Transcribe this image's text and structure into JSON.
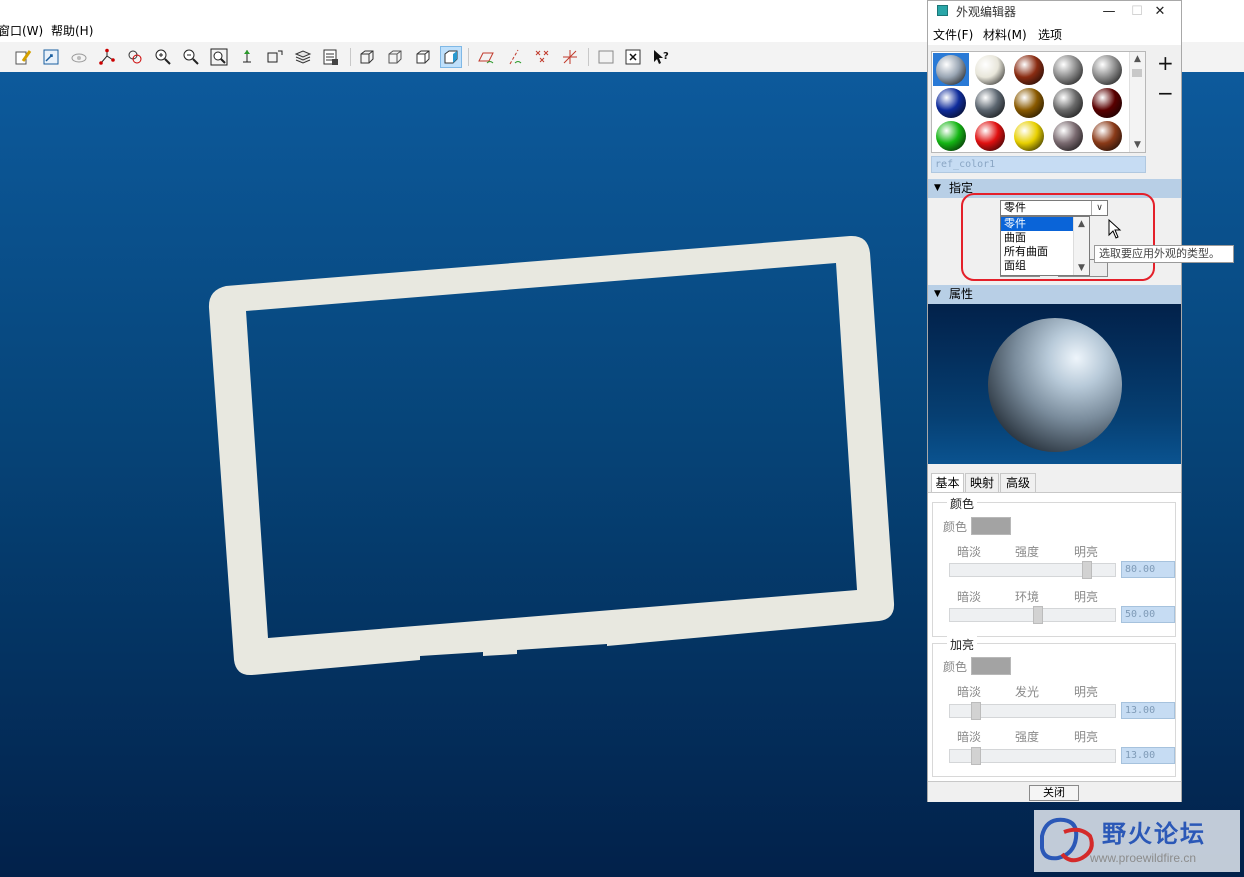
{
  "app": {
    "menus": [
      {
        "label": "窗口(W)"
      },
      {
        "label": "帮助(H)"
      }
    ]
  },
  "toolbar_icons": [
    "repaint-icon",
    "zoom-fit-view-icon",
    "spin-center-icon",
    "datum-points-icon",
    "saved-views-icon",
    "zoom-in-icon",
    "zoom-out-icon",
    "refit-icon",
    "orient-icon",
    "reorient-view-icon",
    "layers-icon",
    "model-tree-icon",
    "wireframe-icon",
    "hidden-line-icon",
    "no-hidden-icon",
    "shading-icon",
    "datum-planes-icon",
    "datum-axes-icon",
    "point-display-icon",
    "csys-display-icon",
    "select-box-icon",
    "close-window-icon",
    "context-help-icon"
  ],
  "dialog": {
    "title": "外观编辑器",
    "menus": [
      {
        "label": "文件(F)"
      },
      {
        "label": "材料(M)"
      },
      {
        "label": "选项"
      }
    ],
    "swatches": [
      {
        "color": "#9aa6b4",
        "selected": true
      },
      {
        "color": "#e8e6da"
      },
      {
        "color": "#8a2c12"
      },
      {
        "color": "#8c8c8c"
      },
      {
        "color": "#8d8d8d"
      },
      {
        "color": "#0f2c9c"
      },
      {
        "color": "#5c6670"
      },
      {
        "color": "#8a5a00"
      },
      {
        "color": "#6a6a6a"
      },
      {
        "color": "#5a0000"
      },
      {
        "color": "#14b614"
      },
      {
        "color": "#e01010"
      },
      {
        "color": "#e8d000"
      },
      {
        "color": "#7a6a70"
      },
      {
        "color": "#8a3a18"
      }
    ],
    "add_label": "+",
    "remove_label": "−",
    "material_name": "ref_color1",
    "assign": {
      "header": "指定",
      "selected": "零件",
      "options": [
        {
          "label": "零件"
        },
        {
          "label": "曲面"
        },
        {
          "label": "所有曲面"
        },
        {
          "label": "面组"
        }
      ],
      "tooltip": "选取要应用外观的类型。"
    },
    "properties": {
      "header": "属性",
      "tabs": [
        {
          "label": "基本"
        },
        {
          "label": "映射"
        },
        {
          "label": "高级"
        }
      ],
      "color_group": {
        "title": "颜色",
        "swatch_label": "颜色",
        "swatch_color": "#a3a3a3",
        "intensity": {
          "dim": "暗淡",
          "mid": "强度",
          "bright": "明亮",
          "value": "80.00",
          "fraction": 0.8
        },
        "ambient": {
          "dim": "暗淡",
          "mid": "环境",
          "bright": "明亮",
          "value": "50.00",
          "fraction": 0.5
        }
      },
      "highlight_group": {
        "title": "加亮",
        "swatch_label": "颜色",
        "swatch_color": "#a3a3a3",
        "shine": {
          "dim": "暗淡",
          "mid": "发光",
          "bright": "明亮",
          "value": "13.00",
          "fraction": 0.13
        },
        "intensity": {
          "dim": "暗淡",
          "mid": "强度",
          "bright": "明亮",
          "value": "13.00",
          "fraction": 0.13
        }
      }
    },
    "close_label": "关闭"
  },
  "watermark": {
    "title": "野火论坛",
    "url": "www.proewildfire.cn"
  }
}
